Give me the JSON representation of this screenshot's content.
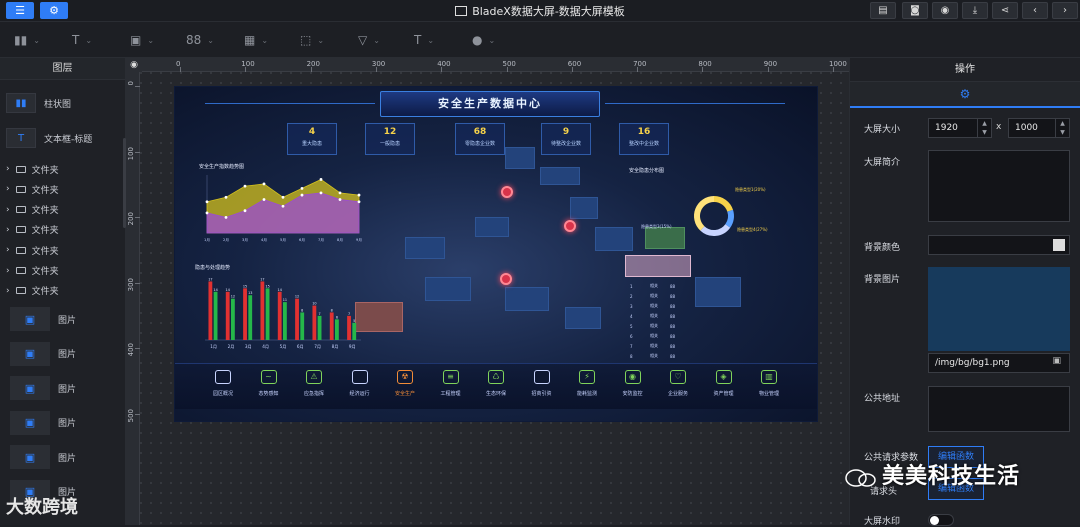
{
  "window": {
    "title": "BladeX数据大屏-数据大屏模板"
  },
  "toolbar": {
    "tools": [
      {
        "name": "bar-chart-tool",
        "glyph": "▮▮",
        "left": 14
      },
      {
        "name": "text-tool",
        "glyph": "T",
        "left": 72
      },
      {
        "name": "image-tool",
        "glyph": "▣",
        "left": 130
      },
      {
        "name": "number-tool",
        "glyph": "88",
        "left": 186
      },
      {
        "name": "table-tool",
        "glyph": "▦",
        "left": 244
      },
      {
        "name": "frame-tool",
        "glyph": "⬚",
        "left": 300
      },
      {
        "name": "filter-tool",
        "glyph": "▽",
        "left": 358
      },
      {
        "name": "format-tool",
        "glyph": "T",
        "left": 414
      },
      {
        "name": "info-tool",
        "glyph": "●",
        "left": 472
      }
    ]
  },
  "layers": {
    "header": "图层",
    "items": [
      {
        "label": "柱状图",
        "glyph": "▮▮"
      },
      {
        "label": "文本框-标题",
        "glyph": "T"
      }
    ],
    "folders": [
      "文件夹",
      "文件夹",
      "文件夹",
      "文件夹",
      "文件夹",
      "文件夹",
      "文件夹"
    ],
    "images": [
      "图片",
      "图片",
      "图片",
      "图片",
      "图片",
      "图片"
    ]
  },
  "ruler": {
    "h_labels": [
      "0",
      "100",
      "200",
      "300",
      "400",
      "500",
      "600",
      "700",
      "800",
      "900",
      "1000"
    ],
    "v_labels": [
      "0",
      "100",
      "200",
      "300",
      "400",
      "500"
    ]
  },
  "board": {
    "title": "安全生产数据中心",
    "stats": [
      {
        "value": "4",
        "label": "重大隐患"
      },
      {
        "value": "12",
        "label": "一般隐患"
      },
      {
        "value": "68",
        "label": "零隐患企业数"
      },
      {
        "value": "9",
        "label": "待整改企业数"
      },
      {
        "value": "16",
        "label": "整改中企业数"
      }
    ],
    "area_chart_title": "安全生产指数趋势图",
    "bar_chart_title": "隐患与处理趋势",
    "pie_title": "安全隐患分布图",
    "pie_labels": [
      "隐患类型1(20%)",
      "隐患类型3(15%)",
      "隐患类型4(27%)"
    ],
    "nav": [
      {
        "label": "园区概况",
        "glyph": "",
        "blank": true
      },
      {
        "label": "态势感知",
        "glyph": "~",
        "blank": false
      },
      {
        "label": "应急指挥",
        "glyph": "⚠",
        "blank": false
      },
      {
        "label": "经济运行",
        "glyph": "",
        "blank": true
      },
      {
        "label": "安全生产",
        "glyph": "☢",
        "blank": false,
        "active": true
      },
      {
        "label": "工程管理",
        "glyph": "≡",
        "blank": false
      },
      {
        "label": "生态环保",
        "glyph": "♺",
        "blank": false
      },
      {
        "label": "招商引资",
        "glyph": "",
        "blank": true
      },
      {
        "label": "能耗监测",
        "glyph": "⚡",
        "blank": false
      },
      {
        "label": "安防监控",
        "glyph": "◉",
        "blank": false
      },
      {
        "label": "企业服务",
        "glyph": "♡",
        "blank": false
      },
      {
        "label": "资产管理",
        "glyph": "◈",
        "blank": false
      },
      {
        "label": "物业管理",
        "glyph": "▥",
        "blank": false
      }
    ]
  },
  "chart_data": [
    {
      "type": "area",
      "title": "安全生产指数趋势图",
      "categories": [
        "1月",
        "2月",
        "3月",
        "4月",
        "5月",
        "6月",
        "7月",
        "8月",
        "9月"
      ],
      "series": [
        {
          "values": [
            14,
            16,
            21,
            22,
            16,
            20,
            24,
            18,
            17
          ],
          "color": "#d4c21d"
        },
        {
          "values": [
            9,
            7,
            10,
            15,
            12,
            17,
            18,
            15,
            14
          ],
          "color": "#9b4bd6"
        }
      ],
      "ylim": [
        0,
        26
      ]
    },
    {
      "type": "bar",
      "title": "隐患与处理趋势",
      "categories": [
        "1月",
        "2月",
        "3月",
        "4月",
        "5月",
        "6月",
        "7月",
        "8月",
        "9月"
      ],
      "series": [
        {
          "values": [
            17,
            14,
            15,
            17,
            14,
            12,
            10,
            8,
            7
          ],
          "color": "#e23131"
        },
        {
          "values": [
            14,
            12,
            13,
            15,
            11,
            8,
            7,
            6,
            5
          ],
          "color": "#25b84a"
        }
      ],
      "ylim": [
        0,
        18
      ]
    },
    {
      "type": "pie",
      "title": "安全隐患分布图",
      "values": [
        20,
        15,
        27,
        38
      ],
      "colors": [
        "#f6d24a",
        "#5aa0ff",
        "#c8d4ff",
        "#ffe27a"
      ]
    }
  ],
  "table": {
    "rows": [
      [
        "1",
        "相关",
        "88"
      ],
      [
        "2",
        "相关",
        "88"
      ],
      [
        "3",
        "相关",
        "88"
      ],
      [
        "4",
        "相关",
        "88"
      ],
      [
        "5",
        "相关",
        "88"
      ],
      [
        "6",
        "相关",
        "88"
      ],
      [
        "7",
        "相关",
        "88"
      ],
      [
        "8",
        "相关",
        "88"
      ]
    ]
  },
  "panel": {
    "header": "操作",
    "size_label": "大屏大小",
    "width": "1920",
    "height": "1000",
    "x_sep": "x",
    "intro_label": "大屏简介",
    "bg_color_label": "背景颜色",
    "bg_image_label": "背景图片",
    "bg_image_path": "/img/bg/bg1.png",
    "public_addr_label": "公共地址",
    "req_params_label": "公共请求参数",
    "req_params_btn": "编辑函数",
    "req_header_label": "请求头",
    "req_header_btn": "编辑函数",
    "watermark_label": "大屏水印"
  },
  "watermarks": {
    "right": "美美科技生活",
    "left": "大数跨境"
  },
  "colors": {
    "accent": "#2f7df6",
    "board_bg": "#152343"
  }
}
